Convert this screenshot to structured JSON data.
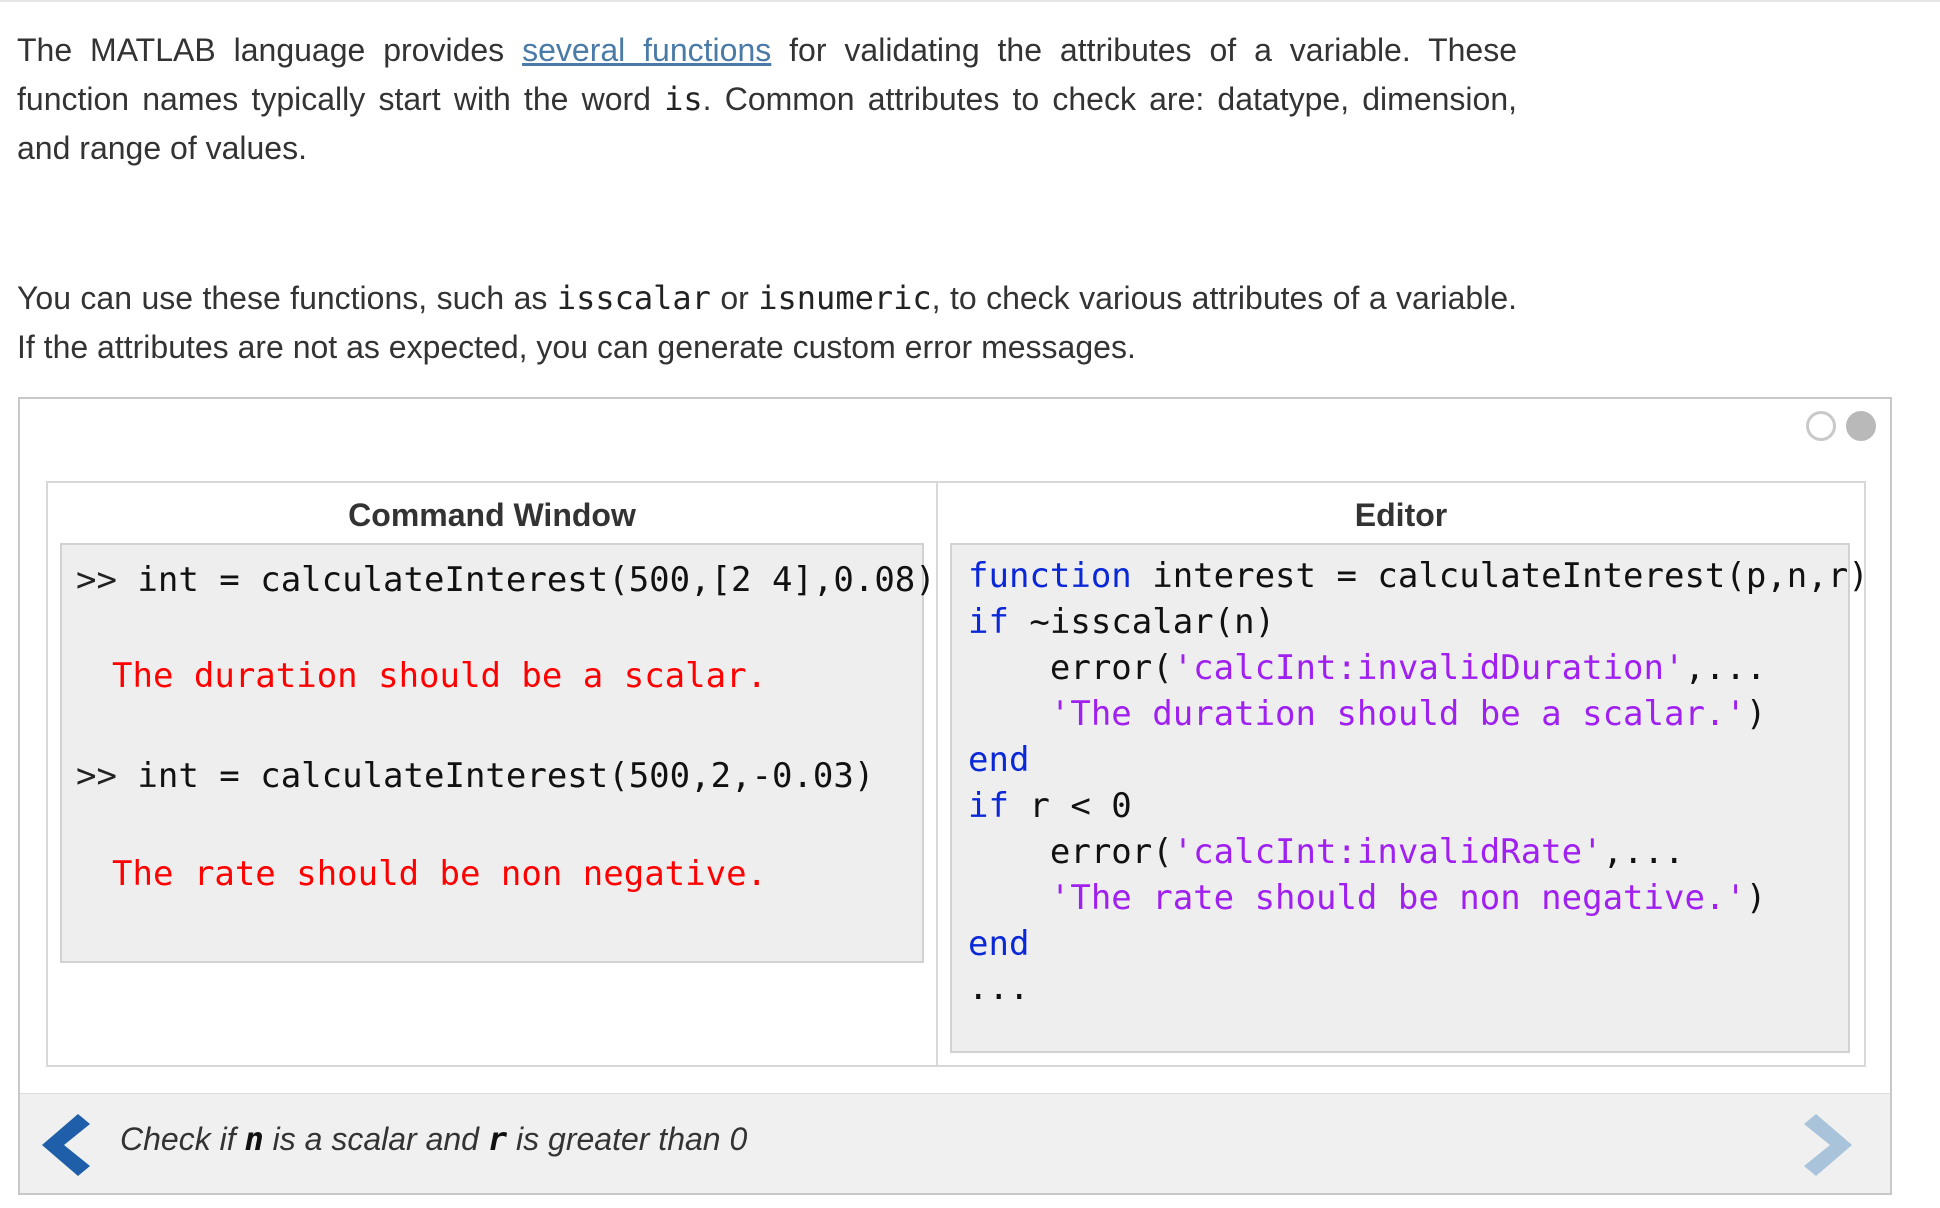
{
  "intro": {
    "p1_before_link": "The MATLAB language provides ",
    "p1_link": "several functions",
    "p1_after_link": " for validating the attributes of a variable. These function names typically start with the word ",
    "p1_code": "is",
    "p1_end": ". Common attributes to check are: datatype, dimension, and range of values.",
    "p2_start": "You can use these functions, such as ",
    "p2_code1": "isscalar",
    "p2_mid": " or ",
    "p2_code2": "isnumeric",
    "p2_end": ", to check various attributes of a variable. If the attributes are not as expected, you can generate custom error messages."
  },
  "slideshow": {
    "pager": {
      "count": 2,
      "active_index": 1
    },
    "command_window": {
      "title": "Command Window",
      "prompt": ">>",
      "cmd1": " int = calculateInterest(500,[2 4],0.08)",
      "err1": "The duration should be a scalar.",
      "cmd2": " int = calculateInterest(500,2,-0.03)",
      "err2": "The rate should be non negative."
    },
    "editor": {
      "title": "Editor",
      "line1_kw": "function",
      "line1_rest": " interest = calculateInterest(p,n,r)",
      "line2_kw": "if",
      "line2_rest": " ~isscalar(n)",
      "line3_pre": "    error(",
      "line3_str": "'calcInt:invalidDuration'",
      "line3_post": ",...",
      "line4_pre": "    ",
      "line4_str": "'The duration should be a scalar.'",
      "line4_post": ")",
      "line5_kw": "end",
      "line6_kw": "if",
      "line6_rest": " r < 0",
      "line7_pre": "    error(",
      "line7_str": "'calcInt:invalidRate'",
      "line7_post": ",...",
      "line8_pre": "    ",
      "line8_str": "'The rate should be non negative.'",
      "line8_post": ")",
      "line9_kw": "end",
      "line10": "..."
    },
    "caption": {
      "part1": "Check if ",
      "var1": "n",
      "part2": " is a scalar and ",
      "var2": "r",
      "part3": " is greater than 0"
    },
    "icons": {
      "prev": "chevron-left-icon",
      "next": "chevron-right-icon"
    },
    "colors": {
      "keyword": "#0a28d8",
      "string": "#a020f0",
      "error": "#ff0000",
      "link": "#4a7aa7",
      "nav_prev": "#1f5ea8",
      "nav_next": "#a9c3db"
    }
  }
}
